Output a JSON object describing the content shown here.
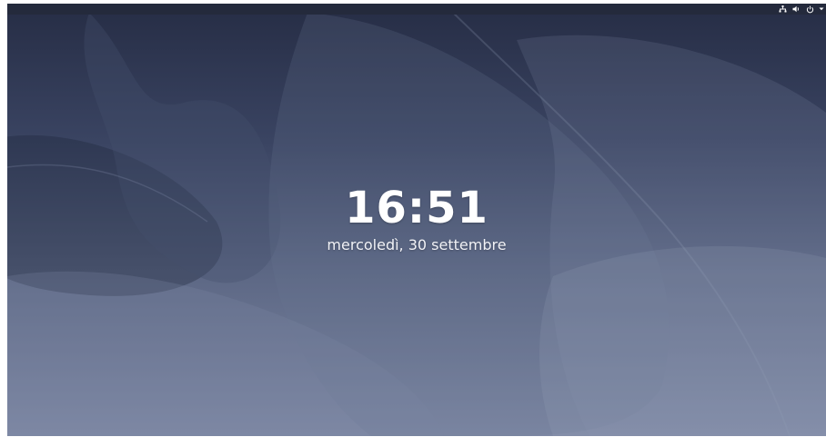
{
  "lock_screen": {
    "time": "16:51",
    "date": "mercoledì, 30 settembre"
  },
  "top_bar": {
    "indicators": [
      {
        "icon": "network-icon"
      },
      {
        "icon": "volume-icon"
      },
      {
        "icon": "power-icon"
      },
      {
        "icon": "dropdown-arrow-icon"
      }
    ]
  },
  "colors": {
    "top_bar": "#242a3c",
    "background_top": "#262d45",
    "background_bottom": "#7f89a5",
    "text": "#ffffff"
  }
}
